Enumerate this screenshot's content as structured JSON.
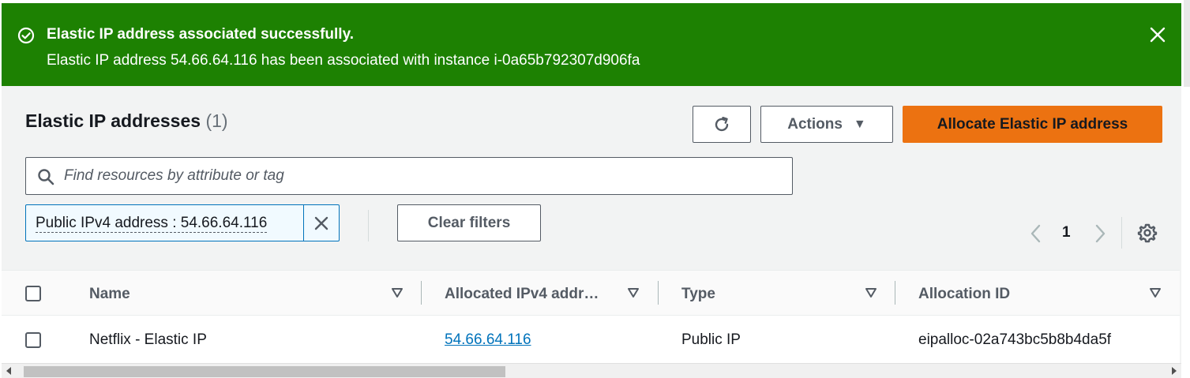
{
  "flash": {
    "title": "Elastic IP address associated successfully.",
    "message": "Elastic IP address 54.66.64.116 has been associated with instance i-0a65b792307d906fa",
    "bg_color": "#1d8102"
  },
  "header": {
    "title": "Elastic IP addresses",
    "count": "(1)"
  },
  "toolbar": {
    "actions_label": "Actions",
    "allocate_label": "Allocate Elastic IP address",
    "allocate_color": "#ec7211"
  },
  "search": {
    "placeholder": "Find resources by attribute or tag"
  },
  "filter_token": {
    "label": "Public IPv4 address : 54.66.64.116"
  },
  "clear_filters_label": "Clear filters",
  "pagination": {
    "current_page": "1"
  },
  "table": {
    "columns": [
      "Name",
      "Allocated IPv4 addr…",
      "Type",
      "Allocation ID"
    ],
    "rows": [
      {
        "name": "Netflix - Elastic IP",
        "ipv4": "54.66.64.116",
        "type": "Public IP",
        "allocation_id": "eipalloc-02a743bc5b8b4da5f"
      }
    ]
  }
}
